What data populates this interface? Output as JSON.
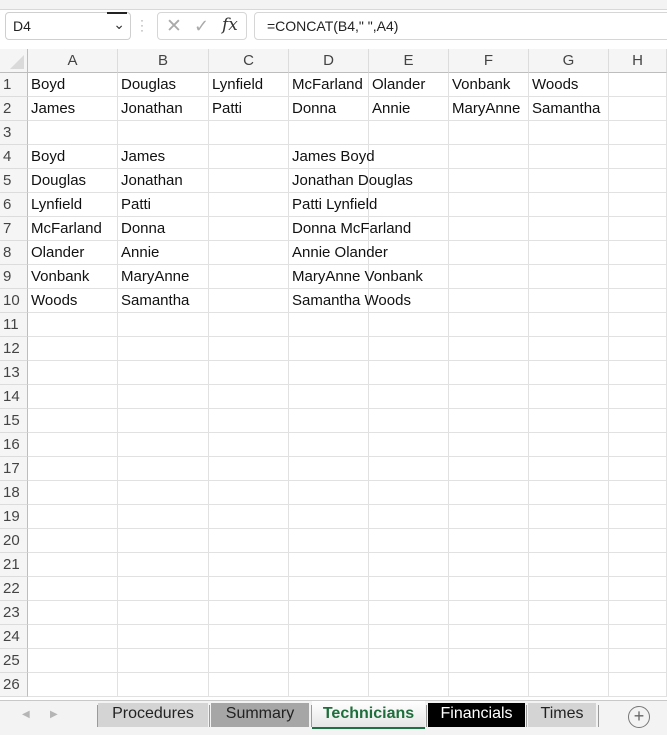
{
  "formula_bar": {
    "name_box": "D4",
    "cancel_icon": "✕",
    "enter_icon": "✓",
    "fx_label": "fx",
    "formula": "=CONCAT(B4,\" \",A4)"
  },
  "columns": [
    "A",
    "B",
    "C",
    "D",
    "E",
    "F",
    "G",
    "H"
  ],
  "rows": [
    "1",
    "2",
    "3",
    "4",
    "5",
    "6",
    "7",
    "8",
    "9",
    "10",
    "11",
    "12",
    "13",
    "14",
    "15",
    "16",
    "17",
    "18",
    "19",
    "20",
    "21",
    "22",
    "23",
    "24",
    "25",
    "26"
  ],
  "cells": {
    "row1": [
      "Boyd",
      "Douglas",
      "Lynfield",
      "McFarland",
      "Olander",
      "Vonbank",
      "Woods",
      ""
    ],
    "row2": [
      "James",
      "Jonathan",
      "Patti",
      "Donna",
      "Annie",
      "MaryAnne",
      "Samantha",
      ""
    ],
    "row4": [
      "Boyd",
      "James",
      "",
      "James Boyd"
    ],
    "row5": [
      "Douglas",
      "Jonathan",
      "",
      "Jonathan Douglas"
    ],
    "row6": [
      "Lynfield",
      "Patti",
      "",
      "Patti Lynfield"
    ],
    "row7": [
      "McFarland",
      "Donna",
      "",
      "Donna McFarland"
    ],
    "row8": [
      "Olander",
      "Annie",
      "",
      "Annie Olander"
    ],
    "row9": [
      "Vonbank",
      "MaryAnne",
      "",
      "MaryAnne Vonbank"
    ],
    "row10": [
      "Woods",
      "Samantha",
      "",
      "Samantha Woods"
    ]
  },
  "sheet_tabs": [
    {
      "label": "Procedures",
      "bg": "#d4d4d4",
      "color": "#222222"
    },
    {
      "label": "Summary",
      "bg": "#a6a6a6",
      "color": "#222222"
    },
    {
      "label": "Technicians",
      "bg": "#ffffff",
      "color": "#1e6e3c",
      "active": true
    },
    {
      "label": "Financials",
      "bg": "#000000",
      "color": "#ffffff"
    },
    {
      "label": "Times",
      "bg": "#d4d4d4",
      "color": "#222222"
    }
  ],
  "add_sheet": "+",
  "colors": {
    "active_tab_accent": "#1e7145"
  }
}
